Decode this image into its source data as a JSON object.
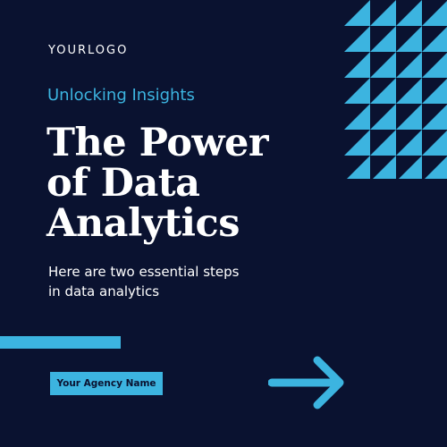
{
  "brand": {
    "logo_text": "YOURLOGO"
  },
  "hero": {
    "kicker": "Unlocking Insights",
    "headline_lines": [
      "The Power",
      "of Data",
      "Analytics"
    ],
    "subtext_lines": [
      "Here are two essential steps",
      "in data analytics"
    ]
  },
  "cta": {
    "agency_label": "Your Agency Name"
  },
  "icons": {
    "arrow": "arrow-right-icon"
  },
  "colors": {
    "background": "#0a1230",
    "accent": "#3cb4e0",
    "text": "#ffffff"
  }
}
